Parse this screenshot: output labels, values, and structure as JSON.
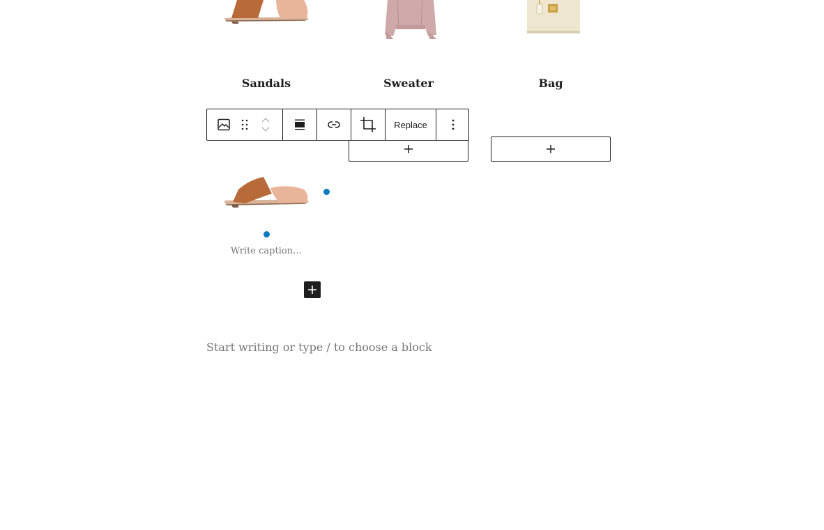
{
  "gallery": {
    "items": [
      {
        "title": "Sandals",
        "image": "sandals-image"
      },
      {
        "title": "Sweater",
        "image": "sweater-image"
      },
      {
        "title": "Bag",
        "image": "bag-image"
      }
    ]
  },
  "toolbar": {
    "replace_label": "Replace"
  },
  "image_block": {
    "caption_placeholder": "Write caption…"
  },
  "editor": {
    "placeholder": "Start writing or type / to choose a block"
  },
  "colors": {
    "handle": "#0a7bbf",
    "text": "#1e1e1e",
    "muted": "#757575"
  }
}
